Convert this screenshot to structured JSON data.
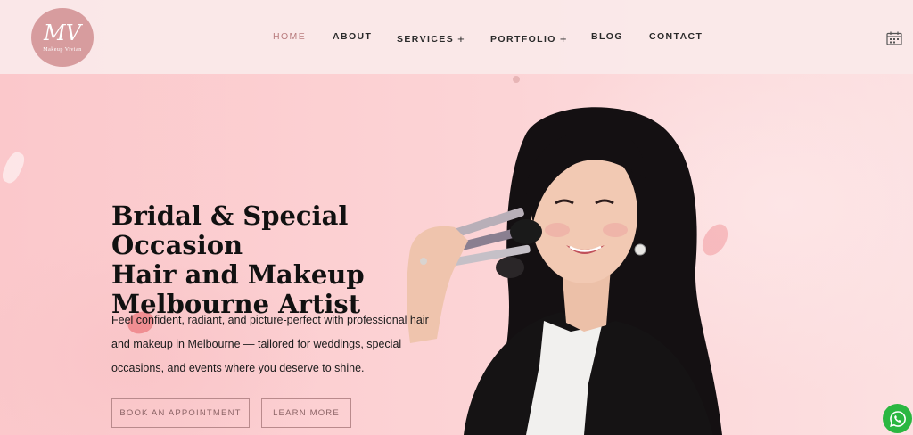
{
  "header": {
    "logo": {
      "monogram": "MV",
      "name": "Makeup Vivian",
      "icon": "brand-logo"
    },
    "nav": [
      {
        "label": "HOME",
        "active": true,
        "has_submenu": false
      },
      {
        "label": "ABOUT",
        "active": false,
        "has_submenu": false
      },
      {
        "label": "SERVICES",
        "active": false,
        "has_submenu": true
      },
      {
        "label": "PORTFOLIO",
        "active": false,
        "has_submenu": true
      },
      {
        "label": "BLOG",
        "active": false,
        "has_submenu": false
      },
      {
        "label": "CONTACT",
        "active": false,
        "has_submenu": false
      }
    ],
    "submenu_glyph": "+",
    "calendar_icon": "calendar-icon"
  },
  "hero": {
    "title_lines": [
      "Bridal & Special Occasion",
      "Hair and Makeup",
      "Melbourne Artist"
    ],
    "description": "Feel confident, radiant, and picture-perfect with professional hair and makeup in Melbourne — tailored for weddings, special occasions, and events where you deserve to shine.",
    "buttons": {
      "book": "BOOK AN APPOINTMENT",
      "learn": "LEARN MORE"
    },
    "image": "woman-holding-makeup-brushes"
  },
  "floating": {
    "whatsapp_icon": "whatsapp-icon"
  },
  "colors": {
    "hero_background": "#fbd0d2",
    "header_background": "#faeaea",
    "accent": "#b87b7d",
    "logo_background": "#d79c9e",
    "whatsapp": "#2bb741"
  }
}
